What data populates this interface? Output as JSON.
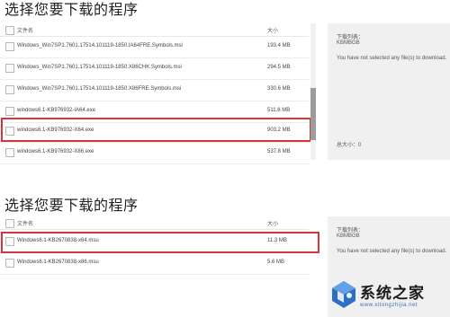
{
  "top": {
    "heading": "选择您要下载的程序",
    "col_name": "文件名",
    "col_size": "大小",
    "files": [
      {
        "name": "Windows_Win7SP1.7601.17514.101119-1850.IA64FRE.Symbols.msi",
        "size": "193.4 MB",
        "checked": false
      },
      {
        "name": "Windows_Win7SP1.7601.17514.101119-1850.X86CHK.Symbols.msi",
        "size": "294.5 MB",
        "checked": false
      },
      {
        "name": "Windows_Win7SP1.7601.17514.101119-1850.X86FRE.Symbols.msi",
        "size": "330.6 MB",
        "checked": false
      },
      {
        "name": "windows6.1-KB976932-IA64.exe",
        "size": "511.6 MB",
        "checked": false
      },
      {
        "name": "windows6.1-KB976932-X64.exe",
        "size": "903.2 MB",
        "checked": false
      },
      {
        "name": "windows6.1-KB976932-X86.exe",
        "size": "537.8 MB",
        "checked": false
      }
    ],
    "side": {
      "list_label": "下载列表：",
      "list_unit": "KBMBGB",
      "empty_msg": "You have not selected any file(s) to download.",
      "total_label": "总大小：",
      "total_value": "0"
    }
  },
  "bottom": {
    "heading": "选择您要下载的程序",
    "col_name": "文件名",
    "col_size": "大小",
    "files": [
      {
        "name": "Windows6.1-KB2670838-x64.msu",
        "size": "11.3 MB",
        "checked": false
      },
      {
        "name": "Windows6.1-KB2670838-x86.msu",
        "size": "5.6 MB",
        "checked": false
      }
    ],
    "side": {
      "list_label": "下载列表：",
      "list_unit": "KBMBGB",
      "empty_msg": "You have not selected any file(s) to download."
    }
  },
  "watermark": {
    "text": "系统之家",
    "url": "www.xitongzhijia.net"
  },
  "colors": {
    "highlight": "#d9333b",
    "side_bg": "#f0f0f0"
  }
}
